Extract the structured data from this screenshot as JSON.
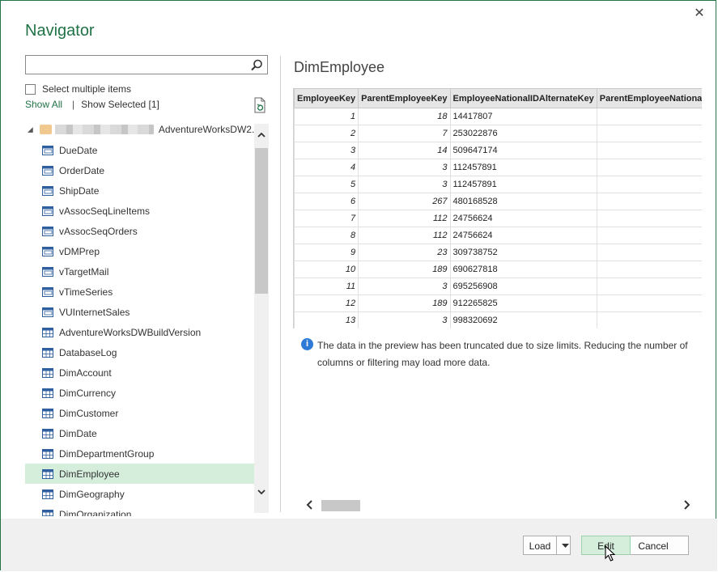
{
  "window": {
    "title": "Navigator",
    "close_glyph": "✕"
  },
  "search": {
    "value": "",
    "placeholder": "",
    "icon": "search-icon"
  },
  "options": {
    "select_multiple_label": "Select multiple items",
    "show_all_label": "Show All",
    "separator": "|",
    "show_selected_label": "Show Selected [1]",
    "refresh_icon": "refresh-icon"
  },
  "tree": {
    "root_label": "AdventureWorksDW2...",
    "items": [
      {
        "label": "DueDate",
        "type": "view"
      },
      {
        "label": "OrderDate",
        "type": "view"
      },
      {
        "label": "ShipDate",
        "type": "view"
      },
      {
        "label": "vAssocSeqLineItems",
        "type": "view"
      },
      {
        "label": "vAssocSeqOrders",
        "type": "view"
      },
      {
        "label": "vDMPrep",
        "type": "view"
      },
      {
        "label": "vTargetMail",
        "type": "view"
      },
      {
        "label": "vTimeSeries",
        "type": "view"
      },
      {
        "label": "VUInternetSales",
        "type": "view"
      },
      {
        "label": "AdventureWorksDWBuildVersion",
        "type": "table"
      },
      {
        "label": "DatabaseLog",
        "type": "table"
      },
      {
        "label": "DimAccount",
        "type": "table"
      },
      {
        "label": "DimCurrency",
        "type": "table"
      },
      {
        "label": "DimCustomer",
        "type": "table"
      },
      {
        "label": "DimDate",
        "type": "table"
      },
      {
        "label": "DimDepartmentGroup",
        "type": "table"
      },
      {
        "label": "DimEmployee",
        "type": "table",
        "selected": true
      },
      {
        "label": "DimGeography",
        "type": "table"
      },
      {
        "label": "DimOrganization",
        "type": "table"
      }
    ]
  },
  "preview": {
    "title": "DimEmployee",
    "columns": [
      "EmployeeKey",
      "ParentEmployeeKey",
      "EmployeeNationalIDAlternateKey",
      "ParentEmployeeNationalIDAlternateKey"
    ],
    "rows": [
      [
        "1",
        "18",
        "14417807",
        ""
      ],
      [
        "2",
        "7",
        "253022876",
        ""
      ],
      [
        "3",
        "14",
        "509647174",
        ""
      ],
      [
        "4",
        "3",
        "112457891",
        ""
      ],
      [
        "5",
        "3",
        "112457891",
        ""
      ],
      [
        "6",
        "267",
        "480168528",
        ""
      ],
      [
        "7",
        "112",
        "24756624",
        ""
      ],
      [
        "8",
        "112",
        "24756624",
        ""
      ],
      [
        "9",
        "23",
        "309738752",
        ""
      ],
      [
        "10",
        "189",
        "690627818",
        ""
      ],
      [
        "11",
        "3",
        "695256908",
        ""
      ],
      [
        "12",
        "189",
        "912265825",
        ""
      ],
      [
        "13",
        "3",
        "998320692",
        ""
      ]
    ],
    "info_text": "The data in the preview has been truncated due to size limits. Reducing the number of columns or filtering may load more data."
  },
  "footer": {
    "load_label": "Load",
    "edit_label": "Edit",
    "cancel_label": "Cancel"
  },
  "colors": {
    "accent": "#217346",
    "selected_row": "#d5eedc",
    "info_blue": "#2d7bd6"
  }
}
